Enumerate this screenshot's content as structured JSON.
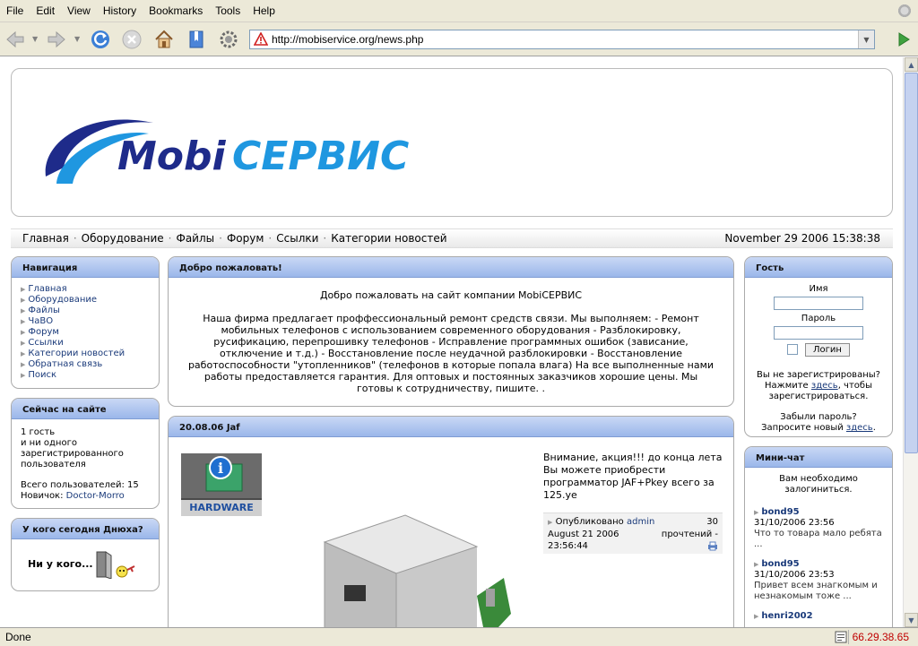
{
  "browser": {
    "menu": [
      "File",
      "Edit",
      "View",
      "History",
      "Bookmarks",
      "Tools",
      "Help"
    ],
    "url": "http://mobiservice.org/news.php",
    "status": "Done",
    "ip": "66.29.38.65"
  },
  "site": {
    "logo_text_a": "Mobi",
    "logo_text_b": "СЕРВИС",
    "nav_links": [
      "Главная",
      "Оборудование",
      "Файлы",
      "Форум",
      "Ссылки",
      "Категории новостей"
    ],
    "datetime": "November 29 2006 15:38:38"
  },
  "navigation": {
    "title": "Навигация",
    "items": [
      "Главная",
      "Оборудование",
      "Файлы",
      "ЧаВО",
      "Форум",
      "Ссылки",
      "Категории новостей",
      "Обратная связь",
      "Поиск"
    ]
  },
  "online": {
    "title": "Сейчас на сайте",
    "guests": "1 гость",
    "members": "и ни одного",
    "members2": "зарегистрированного",
    "members3": "пользователя",
    "total_label": "Всего пользователей:",
    "total": "15",
    "newest_label": "Новичок:",
    "newest": "Doctor-Morro"
  },
  "birthday": {
    "title": "У кого сегодня Днюха?",
    "text": "Ни у кого..."
  },
  "welcome": {
    "title": "Добро пожаловать!",
    "heading": "Добро пожаловать на сайт компании MobiСЕРВИС",
    "body": "Наша фирма предлагает проффессиональный ремонт средств связи. Мы выполняем: - Ремонт мобильных телефонов с использованием современного оборудования - Разблокировку, русификацию, перепрошивку телефонов - Исправление программных ошибок (зависание, отключение и т.д.) - Восстановление после неудачной разблокировки - Восстановление работоспособности \"утопленников\" (телефонов в которые попала влага) На все выполненные нами работы предоставляется гарантия. Для оптовых и постоянных заказчиков хорошие цены. Мы готовы к сотрудничеству, пишите. ."
  },
  "news": {
    "title": "20.08.06 Jaf",
    "badge": "HARDWARE",
    "text": "Внимание, акция!!! до конца лета Вы можете приобрести программатор JAF+Pkey всего за 125.уе",
    "posted_label": "Опубликовано",
    "author": "admin",
    "date": "August 21 2006",
    "time": "23:56:44",
    "reads": "30",
    "reads_label": "прочтений -"
  },
  "guest": {
    "title": "Гость",
    "name_label": "Имя",
    "pass_label": "Пароль",
    "login_btn": "Логин",
    "reg_q": "Вы не зарегистрированы?",
    "reg_1": "Нажмите",
    "reg_link": "здесь",
    "reg_2": ", чтобы",
    "reg_3": "зарегистрироваться.",
    "forgot": "Забыли пароль?",
    "forgot_2": "Запросите новый",
    "forgot_link": "здесь"
  },
  "chat": {
    "title": "Мини-чат",
    "note": "Вам необходимо залогиниться.",
    "messages": [
      {
        "user": "bond95",
        "time": "31/10/2006 23:56",
        "text": "Что то товара мало ребята ..."
      },
      {
        "user": "bond95",
        "time": "31/10/2006 23:53",
        "text": "Привет всем знагкомым и незнакомым тоже ..."
      },
      {
        "user": "henri2002",
        "time": "",
        "text": ""
      }
    ]
  },
  "colors": {
    "accent": "#1a3a7a",
    "panel_header": "#9bb7ea",
    "logo_dark": "#1e2b8a",
    "logo_light": "#1f97e0"
  }
}
